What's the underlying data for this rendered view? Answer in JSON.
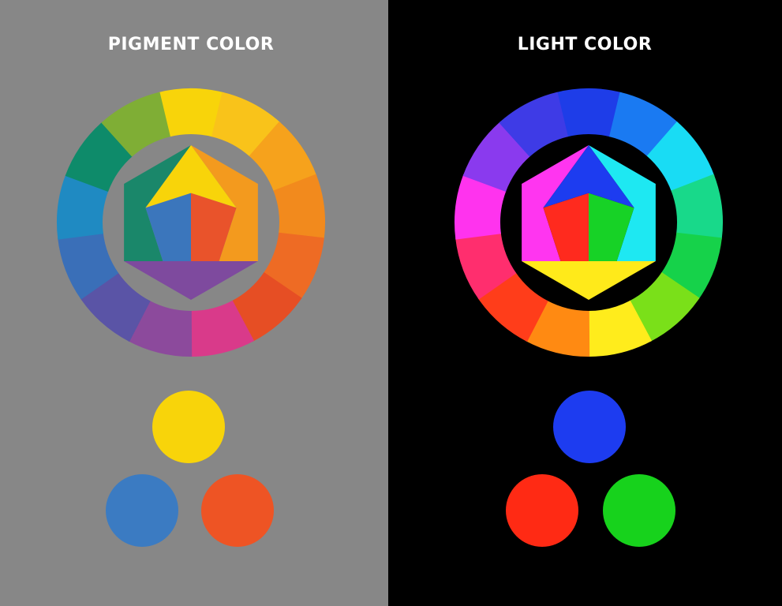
{
  "pigment": {
    "title": "PIGMENT COLOR",
    "background": "#878787",
    "wheel_colors": [
      "#f8d40a",
      "#f9c31a",
      "#f6a21c",
      "#f28a1d",
      "#ee6b24",
      "#e64e24",
      "#d93a8a",
      "#8c4a9c",
      "#5a54a6",
      "#3a6fb8",
      "#1f8ac2",
      "#0e8b6a",
      "#7fae35"
    ],
    "hexagon": {
      "top": "#f8d40a",
      "upper_right": "#f39a1e",
      "lower_right": "#e9532b",
      "bottom": "#7e4a9e",
      "lower_left": "#3b76bc",
      "upper_left": "#1a876a"
    },
    "primaries": [
      "#f8d40a",
      "#3b7bc2",
      "#ee5424"
    ]
  },
  "light": {
    "title": "LIGHT COLOR",
    "background": "#000000",
    "wheel_colors": [
      "#1e3de8",
      "#1a7af2",
      "#19dcf4",
      "#18d98a",
      "#16d24a",
      "#7ae019",
      "#ffec1c",
      "#ff8a12",
      "#ff3d1a",
      "#ff2e6e",
      "#ff33ee",
      "#8a3aee",
      "#3e3be6"
    ],
    "hexagon": {
      "top": "#1d3cf0",
      "upper_right": "#1ee8f2",
      "lower_right": "#17d226",
      "bottom": "#ffea1a",
      "lower_left": "#ff2a1e",
      "upper_left": "#ff35f0"
    },
    "primaries": [
      "#1d3cf0",
      "#ff2a14",
      "#17d21c"
    ]
  }
}
